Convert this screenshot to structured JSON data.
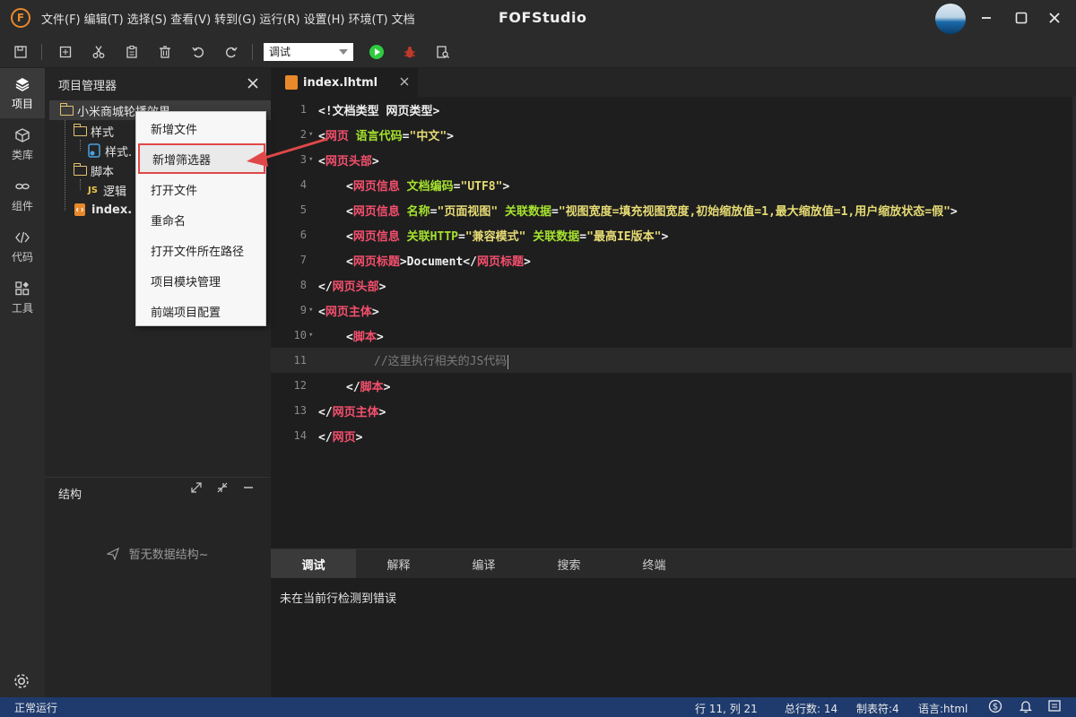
{
  "titlebar": {
    "logo_letter": "F",
    "menus": [
      "文件(F)",
      "编辑(T)",
      "选择(S)",
      "查看(V)",
      "转到(G)",
      "运行(R)",
      "设置(H)",
      "环境(T)",
      "文档"
    ],
    "app_title": "FOFStudio"
  },
  "toolbar": {
    "mode_select_value": "调试",
    "icons": [
      "save-icon",
      "new-file-icon",
      "cut-icon",
      "paste-icon",
      "delete-icon",
      "undo-icon",
      "redo-icon",
      "run-icon",
      "debug-icon",
      "find-file-icon"
    ]
  },
  "activity": {
    "items": [
      {
        "label": "项目",
        "icon": "layers-icon"
      },
      {
        "label": "类库",
        "icon": "package-icon"
      },
      {
        "label": "组件",
        "icon": "link-icon"
      },
      {
        "label": "代码",
        "icon": "code-icon"
      },
      {
        "label": "工具",
        "icon": "tools-icon"
      }
    ],
    "settings_icon": "gear-icon"
  },
  "project": {
    "title": "项目管理器",
    "root": "小米商城轮播效果",
    "style_folder": "样式",
    "style_file": "样式.",
    "script_folder": "脚本",
    "script_badge": "JS",
    "script_file": "逻辑",
    "index_file": "index."
  },
  "structure": {
    "title": "结构",
    "empty": "暂无数据结构~"
  },
  "context_menu": {
    "items": [
      "新增文件",
      "新增筛选器",
      "打开文件",
      "重命名",
      "打开文件所在路径",
      "项目模块管理",
      "前端项目配置"
    ]
  },
  "editor": {
    "tab_label": "index.lhtml",
    "lines": [
      {
        "n": "1",
        "fold": false,
        "indent": 0,
        "tokens": [
          [
            "w",
            "<!文档类型 网页类型>"
          ]
        ]
      },
      {
        "n": "2",
        "fold": true,
        "indent": 0,
        "tokens": [
          [
            "w",
            "<"
          ],
          [
            "r",
            "网页"
          ],
          [
            "g",
            " 语言代码"
          ],
          [
            "w",
            "="
          ],
          [
            "y",
            "\"中文\""
          ],
          [
            "w",
            ">"
          ]
        ]
      },
      {
        "n": "3",
        "fold": true,
        "indent": 0,
        "tokens": [
          [
            "w",
            "<"
          ],
          [
            "r",
            "网页头部"
          ],
          [
            "w",
            ">"
          ]
        ]
      },
      {
        "n": "4",
        "fold": false,
        "indent": 1,
        "tokens": [
          [
            "w",
            "<"
          ],
          [
            "r",
            "网页信息"
          ],
          [
            "g",
            " 文档编码"
          ],
          [
            "w",
            "="
          ],
          [
            "y",
            "\"UTF8\""
          ],
          [
            "w",
            ">"
          ]
        ]
      },
      {
        "n": "5",
        "fold": false,
        "indent": 1,
        "tokens": [
          [
            "w",
            "<"
          ],
          [
            "r",
            "网页信息"
          ],
          [
            "g",
            " 名称"
          ],
          [
            "w",
            "="
          ],
          [
            "y",
            "\"页面视图\""
          ],
          [
            "g",
            " 关联数据"
          ],
          [
            "w",
            "="
          ],
          [
            "y",
            "\"视图宽度=填充视图宽度,初始缩放值=1,最大缩放值=1,用户缩放状态=假\""
          ],
          [
            "w",
            ">"
          ]
        ]
      },
      {
        "n": "6",
        "fold": false,
        "indent": 1,
        "tokens": [
          [
            "w",
            "<"
          ],
          [
            "r",
            "网页信息"
          ],
          [
            "g",
            " 关联HTTP"
          ],
          [
            "w",
            "="
          ],
          [
            "y",
            "\"兼容模式\""
          ],
          [
            "g",
            " 关联数据"
          ],
          [
            "w",
            "="
          ],
          [
            "y",
            "\"最高IE版本\""
          ],
          [
            "w",
            ">"
          ]
        ]
      },
      {
        "n": "7",
        "fold": false,
        "indent": 1,
        "tokens": [
          [
            "w",
            "<"
          ],
          [
            "r",
            "网页标题"
          ],
          [
            "w",
            ">Document</"
          ],
          [
            "r",
            "网页标题"
          ],
          [
            "w",
            ">"
          ]
        ]
      },
      {
        "n": "8",
        "fold": false,
        "indent": 0,
        "tokens": [
          [
            "w",
            "</"
          ],
          [
            "r",
            "网页头部"
          ],
          [
            "w",
            ">"
          ]
        ]
      },
      {
        "n": "9",
        "fold": true,
        "indent": 0,
        "tokens": [
          [
            "w",
            "<"
          ],
          [
            "r",
            "网页主体"
          ],
          [
            "w",
            ">"
          ]
        ]
      },
      {
        "n": "10",
        "fold": true,
        "indent": 1,
        "tokens": [
          [
            "w",
            "<"
          ],
          [
            "r",
            "脚本"
          ],
          [
            "w",
            ">"
          ]
        ]
      },
      {
        "n": "11",
        "fold": false,
        "indent": 2,
        "current": true,
        "tokens": [
          [
            "c",
            "//这里执行相关的JS代码"
          ]
        ]
      },
      {
        "n": "12",
        "fold": false,
        "indent": 1,
        "tokens": [
          [
            "w",
            "</"
          ],
          [
            "r",
            "脚本"
          ],
          [
            "w",
            ">"
          ]
        ]
      },
      {
        "n": "13",
        "fold": false,
        "indent": 0,
        "tokens": [
          [
            "w",
            "</"
          ],
          [
            "r",
            "网页主体"
          ],
          [
            "w",
            ">"
          ]
        ]
      },
      {
        "n": "14",
        "fold": false,
        "indent": 0,
        "tokens": [
          [
            "w",
            "</"
          ],
          [
            "r",
            "网页"
          ],
          [
            "w",
            ">"
          ]
        ]
      }
    ]
  },
  "bottom": {
    "tabs": [
      "调试",
      "解释",
      "编译",
      "搜索",
      "终端"
    ],
    "message": "未在当前行检测到错误"
  },
  "status": {
    "state": "正常运行",
    "position": "行 11, 列 21",
    "total_lines": "总行数: 14",
    "tab_size": "制表符:4",
    "language": "语言:html"
  },
  "colors": {
    "accent": "#e8892b",
    "status_bar": "#1f3b6e",
    "highlight_border": "#e04848"
  }
}
